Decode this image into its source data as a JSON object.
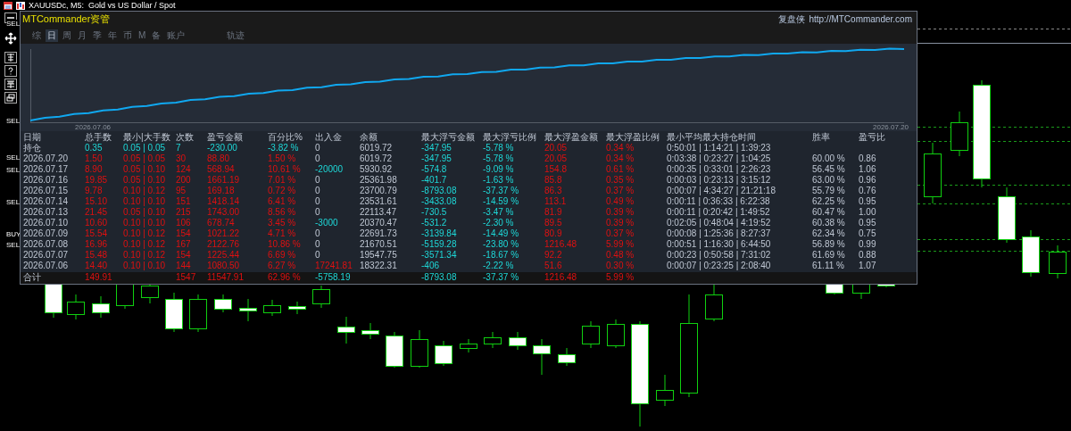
{
  "window": {
    "title": "XAUUSDc, M5:  Gold vs US Dollar / Spot"
  },
  "trade_labels": [
    {
      "text": "SEL"
    },
    {
      "text": "SEL"
    },
    {
      "text": "SEL"
    },
    {
      "text": "SEL"
    },
    {
      "text": "SEL"
    },
    {
      "text": "BUY"
    },
    {
      "text": "SEL"
    }
  ],
  "panel": {
    "title": "MTCommander资管",
    "brand": "复盘侠",
    "link": "http://MTCommander.com",
    "tabs": [
      {
        "label": "综",
        "selected": false
      },
      {
        "label": "日",
        "selected": true
      },
      {
        "label": "周",
        "selected": false
      },
      {
        "label": "月",
        "selected": false
      },
      {
        "label": "季",
        "selected": false
      },
      {
        "label": "年",
        "selected": false
      },
      {
        "label": "币",
        "selected": false
      },
      {
        "label": "M",
        "selected": false
      },
      {
        "label": "备",
        "selected": false
      },
      {
        "label": "账户",
        "selected": false
      },
      {
        "label": "轨迹",
        "selected": false
      }
    ],
    "equity_chart": {
      "start_label": "2026.07.06",
      "end_label": "2026.07.20"
    },
    "table": {
      "columns": [
        "日期",
        "总手数",
        "最小|大手数",
        "次数",
        "盈亏金额",
        "百分比%",
        "出入金",
        "余额",
        "最大浮亏金额",
        "最大浮亏比例",
        "最大浮盈金额",
        "最大浮盈比例",
        "最小平均最大持仓时间",
        "胜率",
        "盈亏比"
      ],
      "rows": [
        {
          "kind": "position",
          "cells": [
            "持仓",
            "0.35",
            "0.05 | 0.05",
            "7",
            "-230.00",
            "-3.82 %",
            {
              "text": "0",
              "kind": "none"
            },
            "6019.72",
            "-347.95",
            "-5.78 %",
            "20.05",
            "0.34 %",
            "0:50:01 | 1:14:21 | 1:39:23",
            null,
            null
          ]
        },
        {
          "kind": "day",
          "cells": [
            "2026.07.20",
            "1.50",
            "0.05 | 0.05",
            "30",
            "88.80",
            "1.50 %",
            {
              "text": "0",
              "kind": "none"
            },
            "6019.72",
            "-347.95",
            "-5.78 %",
            "20.05",
            "0.34 %",
            "0:03:38 | 0:23:27 | 1:04:25",
            "60.00 %",
            "0.86"
          ]
        },
        {
          "kind": "day",
          "cells": [
            "2026.07.17",
            "8.90",
            "0.05 | 0.10",
            "124",
            "568.94",
            "10.61 %",
            {
              "text": "-20000",
              "kind": "withdrawal"
            },
            "5930.92",
            "-574.8",
            "-9.09 %",
            "154.8",
            "0.61 %",
            "0:00:35 | 0:33:01 | 2:26:23",
            "56.45 %",
            "1.06"
          ]
        },
        {
          "kind": "day",
          "cells": [
            "2026.07.16",
            "19.85",
            "0.05 | 0.10",
            "200",
            "1661.19",
            "7.01 %",
            {
              "text": "0",
              "kind": "none"
            },
            "25361.98",
            "-401.7",
            "-1.63 %",
            "85.8",
            "0.35 %",
            "0:00:03 | 0:23:13 | 3:15:12",
            "63.00 %",
            "0.96"
          ]
        },
        {
          "kind": "day",
          "cells": [
            "2026.07.15",
            "9.78",
            "0.10 | 0.12",
            "95",
            "169.18",
            "0.72 %",
            {
              "text": "0",
              "kind": "none"
            },
            "23700.79",
            "-8793.08",
            "-37.37 %",
            "86.3",
            "0.37 %",
            "0:00:07 | 4:34:27 | 21:21:18",
            "55.79 %",
            "0.76"
          ]
        },
        {
          "kind": "day",
          "cells": [
            "2026.07.14",
            "15.10",
            "0.10 | 0.10",
            "151",
            "1418.14",
            "6.41 %",
            {
              "text": "0",
              "kind": "none"
            },
            "23531.61",
            "-3433.08",
            "-14.59 %",
            "113.1",
            "0.49 %",
            "0:00:11 | 0:36:33 | 6:22:38",
            "62.25 %",
            "0.95"
          ]
        },
        {
          "kind": "day",
          "cells": [
            "2026.07.13",
            "21.45",
            "0.05 | 0.10",
            "215",
            "1743.00",
            "8.56 %",
            {
              "text": "0",
              "kind": "none"
            },
            "22113.47",
            "-730.5",
            "-3.47 %",
            "81.9",
            "0.39 %",
            "0:00:11 | 0:20:42 | 1:49:52",
            "60.47 %",
            "1.00"
          ]
        },
        {
          "kind": "day",
          "cells": [
            "2026.07.10",
            "10.60",
            "0.10 | 0.10",
            "106",
            "678.74",
            "3.45 %",
            {
              "text": "-3000",
              "kind": "withdrawal"
            },
            "20370.47",
            "-531.2",
            "-2.30 %",
            "89.5",
            "0.39 %",
            "0:02:05 | 0:48:04 | 4:19:52",
            "60.38 %",
            "0.95"
          ]
        },
        {
          "kind": "day",
          "cells": [
            "2026.07.09",
            "15.54",
            "0.10 | 0.12",
            "154",
            "1021.22",
            "4.71 %",
            {
              "text": "0",
              "kind": "none"
            },
            "22691.73",
            "-3139.84",
            "-14.49 %",
            "80.9",
            "0.37 %",
            "0:00:08 | 1:25:36 | 8:27:37",
            "62.34 %",
            "0.75"
          ]
        },
        {
          "kind": "day",
          "cells": [
            "2026.07.08",
            "16.96",
            "0.10 | 0.12",
            "167",
            "2122.76",
            "10.86 %",
            {
              "text": "0",
              "kind": "none"
            },
            "21670.51",
            "-5159.28",
            "-23.80 %",
            "1216.48",
            "5.99 %",
            "0:00:51 | 1:16:30 | 6:44:50",
            "56.89 %",
            "0.99"
          ]
        },
        {
          "kind": "day",
          "cells": [
            "2026.07.07",
            "15.48",
            "0.10 | 0.12",
            "154",
            "1225.44",
            "6.69 %",
            {
              "text": "0",
              "kind": "none"
            },
            "19547.75",
            "-3571.34",
            "-18.67 %",
            "92.2",
            "0.48 %",
            "0:00:23 | 0:50:58 | 7:31:02",
            "61.69 %",
            "0.88"
          ]
        },
        {
          "kind": "day",
          "cells": [
            "2026.07.06",
            "14.40",
            "0.10 | 0.10",
            "144",
            "1080.50",
            "6.27 %",
            {
              "text": "17241.81",
              "kind": "deposit"
            },
            "18322.31",
            "-406",
            "-2.22 %",
            "51.6",
            "0.30 %",
            "0:00:07 | 0:23:25 | 2:08:40",
            "61.11 %",
            "1.07"
          ]
        },
        {
          "kind": "total",
          "cells": [
            "合计",
            "149.91",
            null,
            "1547",
            "11547.91",
            "62.96 %",
            {
              "text": "-5758.19",
              "kind": "withdrawal"
            },
            null,
            "-8793.08",
            "-37.37 %",
            "1216.48",
            "5.99 %",
            null,
            null,
            null
          ]
        }
      ]
    }
  }
}
